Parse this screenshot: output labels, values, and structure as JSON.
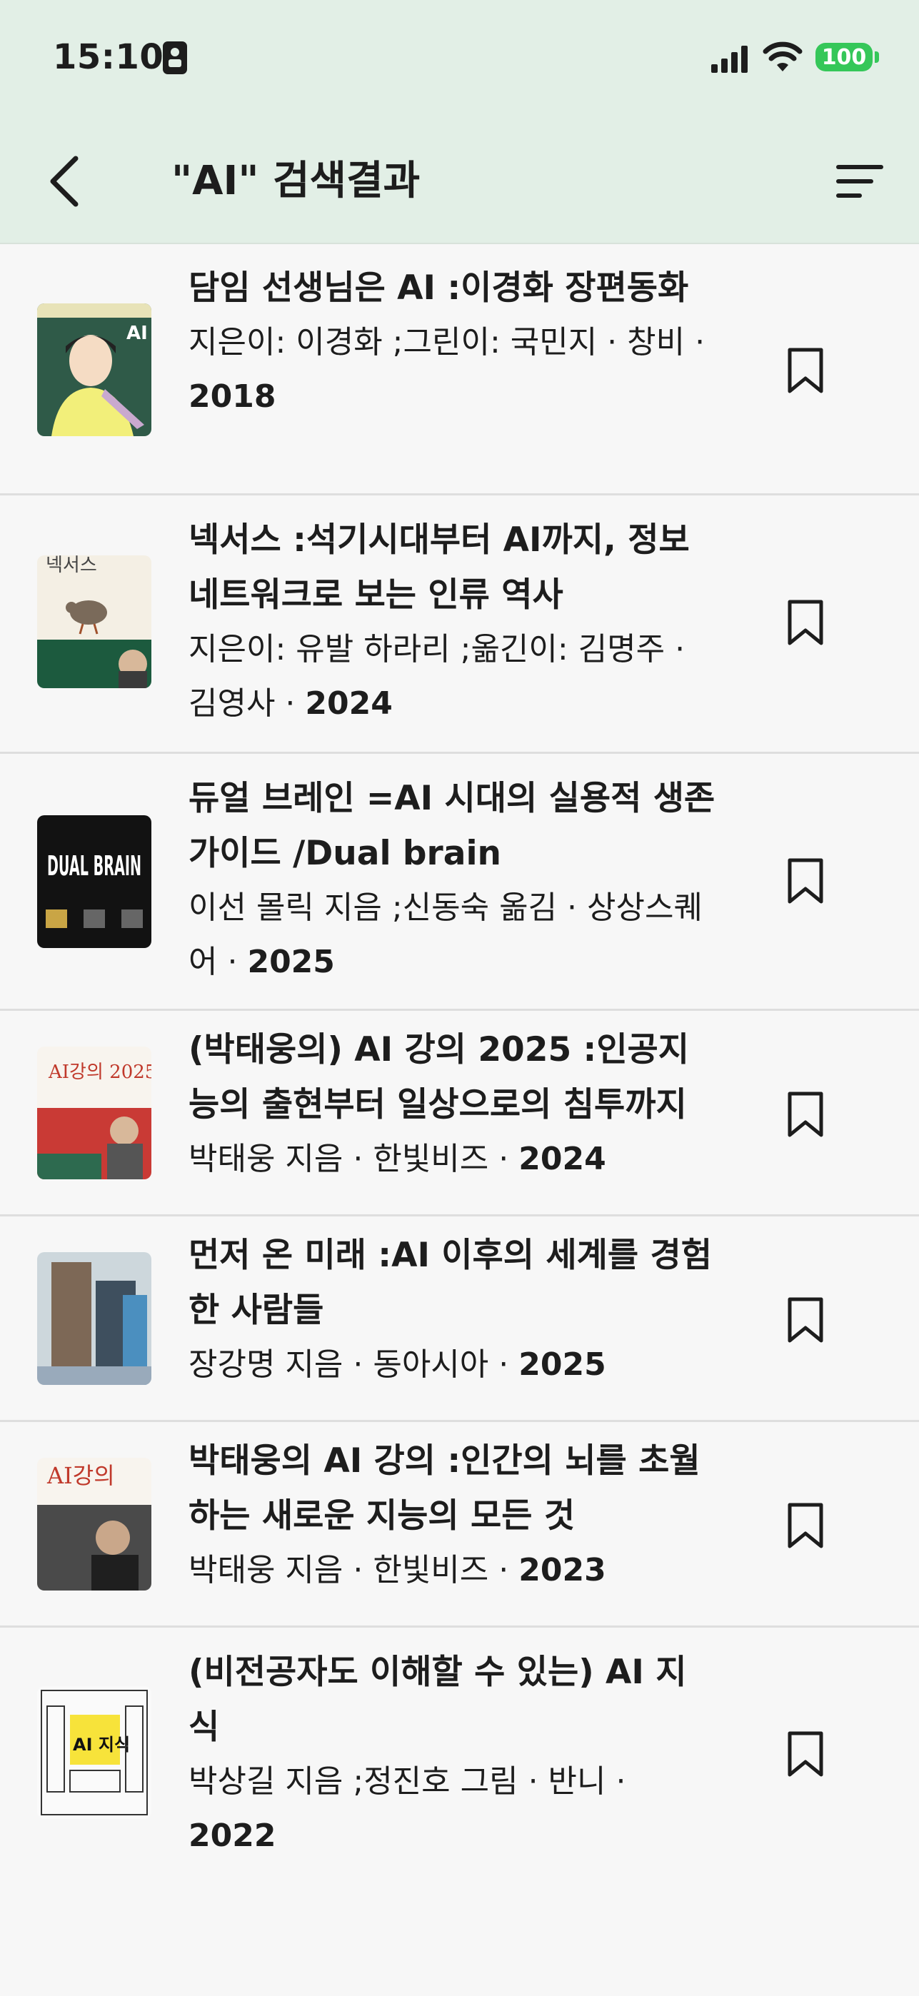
{
  "status": {
    "time": "15:10",
    "battery": "100"
  },
  "header": {
    "title": "\"AI\" 검색결과"
  },
  "results": [
    {
      "title": "담임 선생님은 AI :이경화 장편동화",
      "meta": "지은이: 이경화 ;그린이: 국민지 · 창비 · ",
      "year": "2018",
      "cover_label": "AI"
    },
    {
      "title": "넥서스 :석기시대부터 AI까지, 정보 네트워크로 보는 인류 역사",
      "meta": "지은이: 유발 하라리 ;옮긴이: 김명주 · 김영사 · ",
      "year": "2024",
      "cover_label": "넥서스"
    },
    {
      "title": "듀얼 브레인 =AI 시대의 실용적 생존 가이드 /Dual brain",
      "meta": "이선 몰릭 지음 ;신동숙 옮김 · 상상스퀘어 · ",
      "year": "2025",
      "cover_label": "DUAL BRAIN"
    },
    {
      "title": "(박태웅의) AI 강의 2025 :인공지능의 출현부터 일상으로의 침투까지",
      "meta": "박태웅 지음 · 한빛비즈 · ",
      "year": "2024",
      "cover_label": "AI강의 2025"
    },
    {
      "title": "먼저 온 미래 :AI 이후의 세계를 경험한 사람들",
      "meta": "장강명 지음 · 동아시아 · ",
      "year": "2025",
      "cover_label": ""
    },
    {
      "title": "박태웅의 AI 강의 :인간의 뇌를 초월하는 새로운 지능의 모든 것",
      "meta": "박태웅 지음 · 한빛비즈 · ",
      "year": "2023",
      "cover_label": "AI강의"
    },
    {
      "title": "(비전공자도 이해할 수 있는) AI 지식",
      "meta": "박상길 지음 ;정진호 그림 · 반니 · ",
      "year": "2022",
      "cover_label": "AI 지식"
    }
  ],
  "colors": {
    "header_bg": "#e2efe6",
    "battery": "#35c759"
  }
}
